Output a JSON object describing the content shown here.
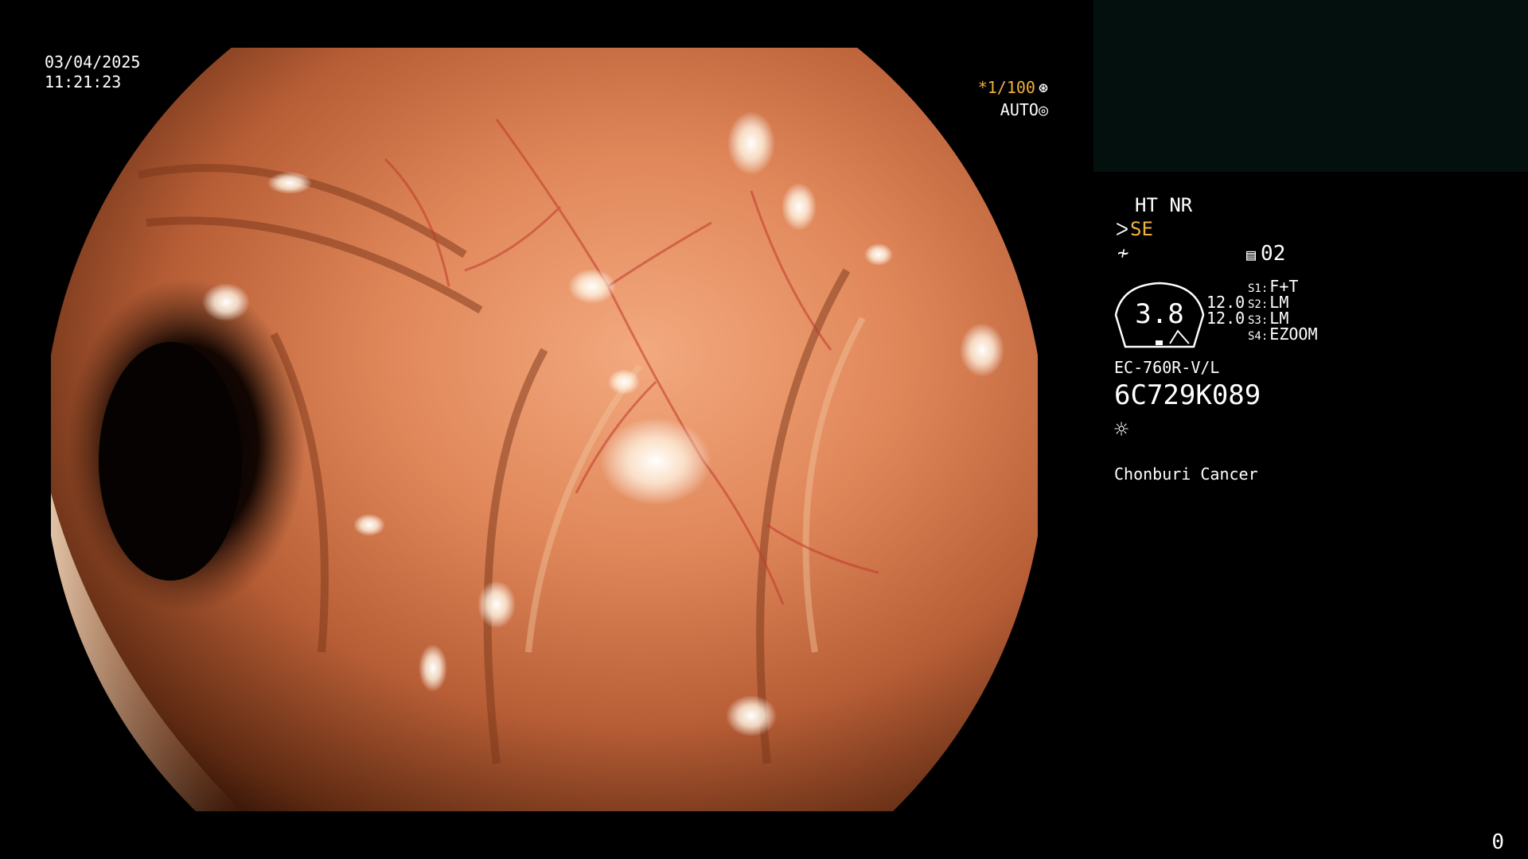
{
  "overlay": {
    "date": "03/04/2025",
    "time": "11:21:23",
    "shutter": "*1/100",
    "shutter_icon": "aperture-icon",
    "mode": "AUTO",
    "mode_icon": "iris-icon"
  },
  "info": {
    "ht_nr": "HT NR",
    "se": "SE",
    "se_icon": "enhance-icon",
    "wave_icon": "wave-icon",
    "page_icon": "list-icon",
    "page_number": "02",
    "gauge_value": "3.8",
    "gauge_nums": [
      "12.0",
      "12.0"
    ],
    "switches": [
      {
        "key": "S1:",
        "value": "F+T"
      },
      {
        "key": "S2:",
        "value": "LM"
      },
      {
        "key": "S3:",
        "value": "LM"
      },
      {
        "key": "S4:",
        "value": "EZOOM"
      }
    ],
    "scope_model": "EC-760R-V/L",
    "serial": "6C729K089",
    "light_icon": "sun-icon",
    "site": "Chonburi Cancer"
  },
  "counter": "0",
  "colors": {
    "accent": "#f0b23c",
    "panel": "#04100e",
    "background": "#000000"
  }
}
